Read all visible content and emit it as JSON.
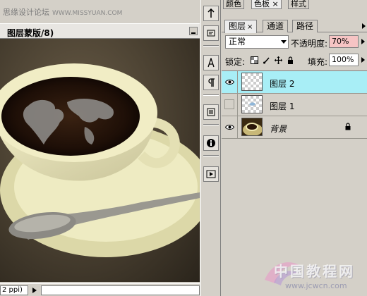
{
  "watermark_top": {
    "text": "思缘设计论坛",
    "url": "WWW.MISSYUAN.COM"
  },
  "document": {
    "title": "图层蒙版/8)",
    "status_zoom": "2 ppi)"
  },
  "panel": {
    "top_tabs": [
      {
        "label": "颜色"
      },
      {
        "label": "色板",
        "close": "×"
      },
      {
        "label": "样式"
      }
    ],
    "tabs": [
      {
        "label": "图层",
        "close": "×",
        "active": true
      },
      {
        "label": "通道"
      },
      {
        "label": "路径"
      }
    ],
    "blend_mode": "正常",
    "opacity_label": "不透明度:",
    "opacity_value": "70%",
    "lock_label": "锁定:",
    "fill_label": "填充:",
    "fill_value": "100%",
    "layers": [
      {
        "name": "图层 2",
        "visible": true,
        "selected": true
      },
      {
        "name": "图层 1",
        "visible": false,
        "selected": false
      },
      {
        "name": "背景",
        "visible": true,
        "selected": false,
        "locked": true
      }
    ]
  },
  "watermark_bottom": {
    "text": "中国教程网",
    "url": "www.jcwcn.com"
  },
  "colors": {
    "selected_layer": "#a8eef6",
    "opacity_highlight": "#f6c4c4"
  }
}
